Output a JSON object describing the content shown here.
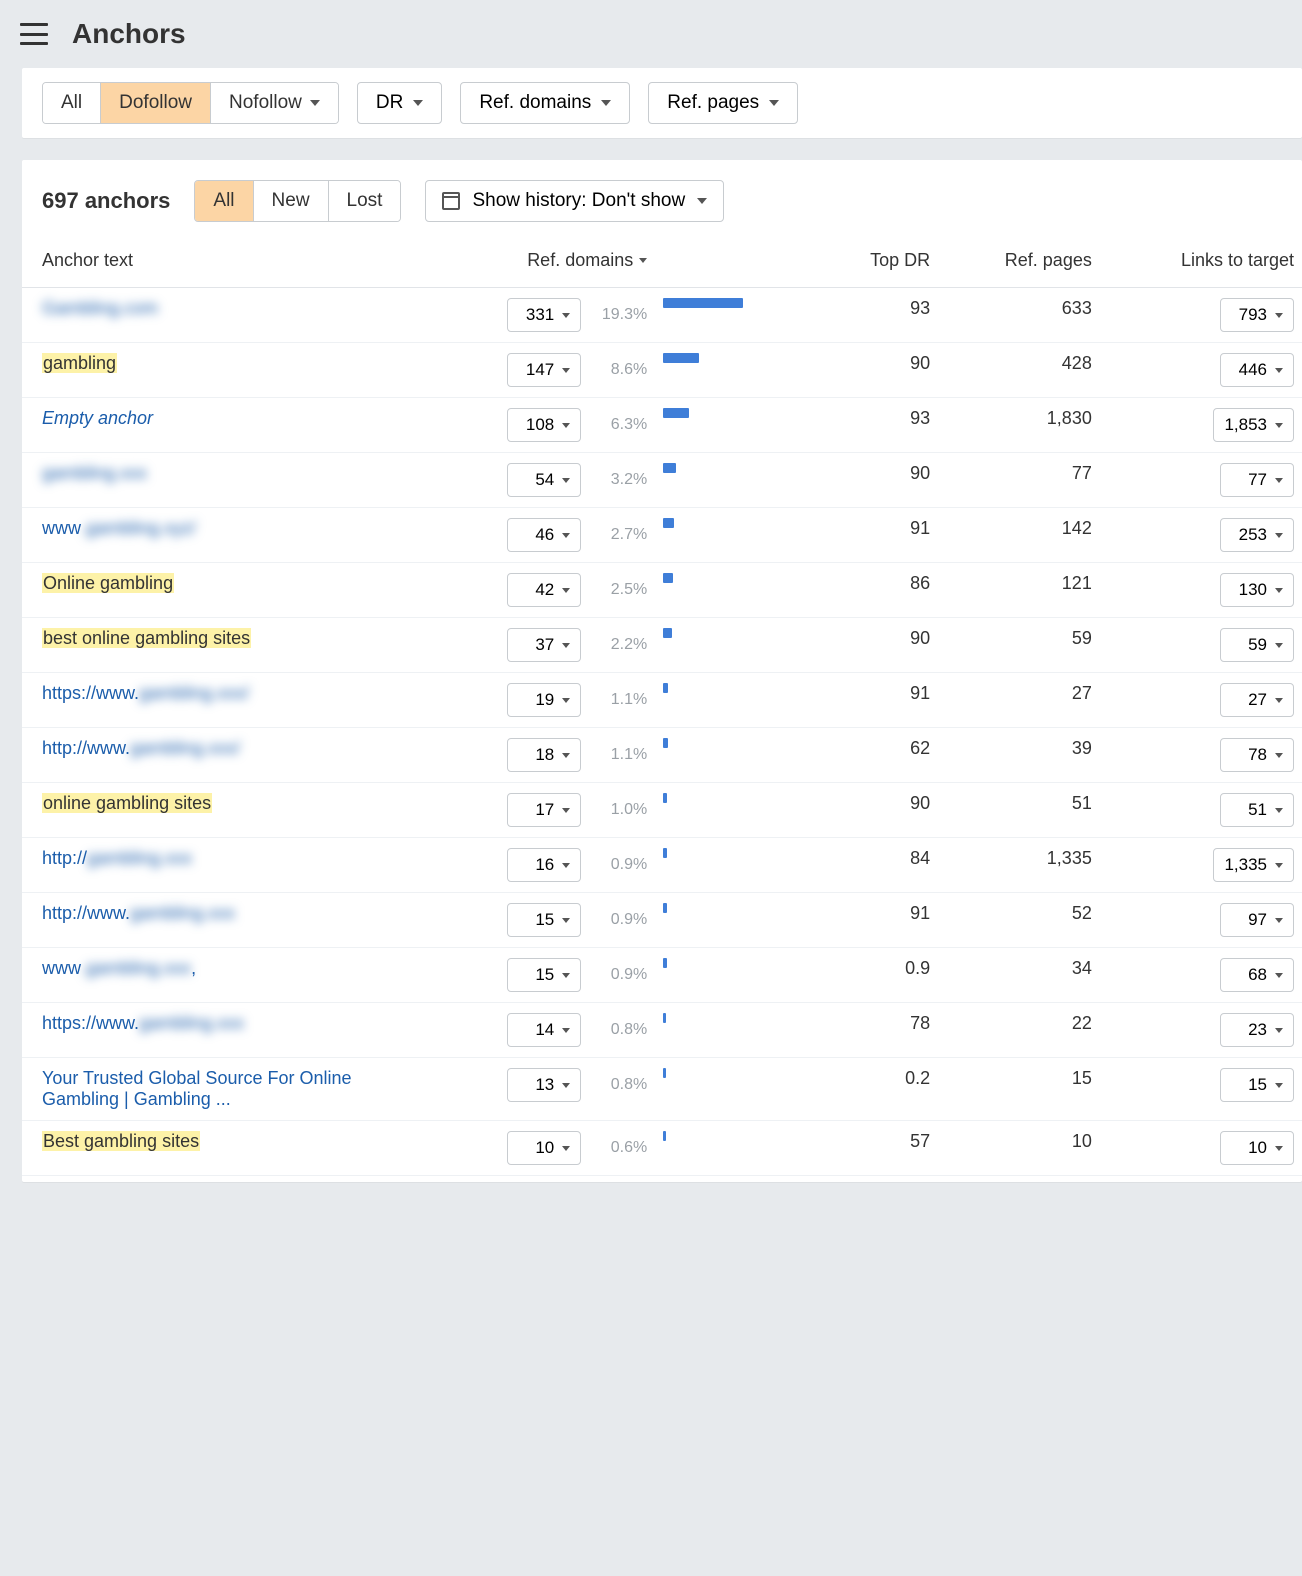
{
  "header": {
    "title": "Anchors"
  },
  "filters": {
    "follow_seg": {
      "all": "All",
      "dofollow": "Dofollow",
      "nofollow": "Nofollow",
      "active": "dofollow"
    },
    "dr": "DR",
    "ref_domains": "Ref. domains",
    "ref_pages": "Ref. pages"
  },
  "subhead": {
    "count": "697 anchors",
    "anl_seg": {
      "all": "All",
      "new": "New",
      "lost": "Lost",
      "active": "all"
    },
    "history_label": "Show history: Don't show"
  },
  "columns": {
    "anchor": "Anchor text",
    "ref_domains": "Ref. domains",
    "top_dr": "Top DR",
    "ref_pages": "Ref. pages",
    "links": "Links to target"
  },
  "max_pct": 19.3,
  "rows": [
    {
      "anchor": {
        "text": "Gambling.com",
        "style": "link",
        "blur": true
      },
      "ref_domains": "331",
      "pct": "19.3%",
      "pct_val": 19.3,
      "top_dr": "93",
      "ref_pages": "633",
      "links": "793"
    },
    {
      "anchor": {
        "text": "gambling",
        "style": "hl"
      },
      "ref_domains": "147",
      "pct": "8.6%",
      "pct_val": 8.6,
      "top_dr": "90",
      "ref_pages": "428",
      "links": "446"
    },
    {
      "anchor": {
        "text": "Empty anchor",
        "style": "italic"
      },
      "ref_domains": "108",
      "pct": "6.3%",
      "pct_val": 6.3,
      "top_dr": "93",
      "ref_pages": "1,830",
      "links": "1,853"
    },
    {
      "anchor": {
        "text": "gambling.xxx",
        "style": "link",
        "blur": true
      },
      "ref_domains": "54",
      "pct": "3.2%",
      "pct_val": 3.2,
      "top_dr": "90",
      "ref_pages": "77",
      "links": "77"
    },
    {
      "anchor": {
        "prefix": "www",
        "text": ".gambling.xyz/",
        "style": "link",
        "blur_suffix": true
      },
      "ref_domains": "46",
      "pct": "2.7%",
      "pct_val": 2.7,
      "top_dr": "91",
      "ref_pages": "142",
      "links": "253"
    },
    {
      "anchor": {
        "text": "Online gambling",
        "style": "hl"
      },
      "ref_domains": "42",
      "pct": "2.5%",
      "pct_val": 2.5,
      "top_dr": "86",
      "ref_pages": "121",
      "links": "130"
    },
    {
      "anchor": {
        "text": "best online gambling sites",
        "style": "hl"
      },
      "ref_domains": "37",
      "pct": "2.2%",
      "pct_val": 2.2,
      "top_dr": "90",
      "ref_pages": "59",
      "links": "59"
    },
    {
      "anchor": {
        "prefix": "https://www.",
        "text": "gambling.xxx/",
        "style": "link",
        "blur_suffix": true
      },
      "ref_domains": "19",
      "pct": "1.1%",
      "pct_val": 1.1,
      "top_dr": "91",
      "ref_pages": "27",
      "links": "27"
    },
    {
      "anchor": {
        "prefix": "http://www.",
        "text": "gambling.xxx/",
        "style": "link",
        "blur_suffix": true
      },
      "ref_domains": "18",
      "pct": "1.1%",
      "pct_val": 1.1,
      "top_dr": "62",
      "ref_pages": "39",
      "links": "78"
    },
    {
      "anchor": {
        "text": "online gambling sites",
        "style": "hl"
      },
      "ref_domains": "17",
      "pct": "1.0%",
      "pct_val": 1.0,
      "top_dr": "90",
      "ref_pages": "51",
      "links": "51"
    },
    {
      "anchor": {
        "prefix": "http://",
        "text": "gambling.xxx",
        "style": "link",
        "blur_suffix": true
      },
      "ref_domains": "16",
      "pct": "0.9%",
      "pct_val": 0.9,
      "top_dr": "84",
      "ref_pages": "1,335",
      "links": "1,335"
    },
    {
      "anchor": {
        "prefix": "http://www.",
        "text": "gambling.xxx",
        "style": "link",
        "blur_suffix": true
      },
      "ref_domains": "15",
      "pct": "0.9%",
      "pct_val": 0.9,
      "top_dr": "91",
      "ref_pages": "52",
      "links": "97"
    },
    {
      "anchor": {
        "prefix": "www",
        "text": ".gambling.xxx",
        "suffix": ",",
        "style": "link",
        "blur_suffix": true
      },
      "ref_domains": "15",
      "pct": "0.9%",
      "pct_val": 0.9,
      "top_dr": "0.9",
      "ref_pages": "34",
      "links": "68"
    },
    {
      "anchor": {
        "prefix": "https://www.",
        "text": "gambling.xxx",
        "style": "link",
        "blur_suffix": true
      },
      "ref_domains": "14",
      "pct": "0.8%",
      "pct_val": 0.8,
      "top_dr": "78",
      "ref_pages": "22",
      "links": "23"
    },
    {
      "anchor": {
        "text": "Your Trusted Global Source For Online Gambling | Gambling ...",
        "style": "link"
      },
      "ref_domains": "13",
      "pct": "0.8%",
      "pct_val": 0.8,
      "top_dr": "0.2",
      "ref_pages": "15",
      "links": "15"
    },
    {
      "anchor": {
        "text": "Best gambling sites",
        "style": "hl"
      },
      "ref_domains": "10",
      "pct": "0.6%",
      "pct_val": 0.6,
      "top_dr": "57",
      "ref_pages": "10",
      "links": "10"
    }
  ]
}
